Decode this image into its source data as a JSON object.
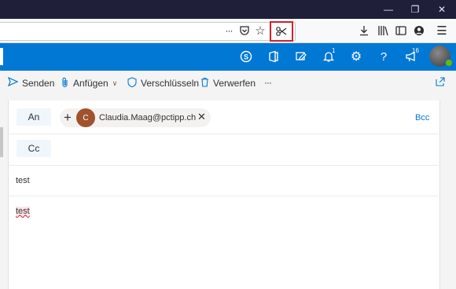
{
  "firefox": {
    "more_label": "···"
  },
  "outlook": {
    "notification_badge": "1",
    "whatsnew_badge": "16"
  },
  "commandbar": {
    "send_label": "Senden",
    "attach_label": "Anfügen",
    "encrypt_label": "Verschlüsseln",
    "discard_label": "Verwerfen",
    "more_label": "···"
  },
  "compose": {
    "to_label": "An",
    "cc_label": "Cc",
    "bcc_label": "Bcc",
    "recipient_initial": "C",
    "recipient_email": "Claudia.Maag@pctipp.ch",
    "subject": "test",
    "body": "test"
  },
  "colors": {
    "outlook_blue": "#0078d4",
    "highlight_red": "#d4202a",
    "avatar_brown": "#a0522d"
  },
  "icons": [
    "minimize-icon",
    "restore-icon",
    "close-icon",
    "more-icon",
    "pocket-icon",
    "bookmark-star-icon",
    "screenshot-icon",
    "download-icon",
    "library-icon",
    "sidebar-icon",
    "account-icon",
    "menu-icon",
    "skype-icon",
    "office-icon",
    "feedback-icon",
    "bell-icon",
    "gear-icon",
    "help-icon",
    "megaphone-icon",
    "send-icon",
    "paperclip-icon",
    "shield-icon",
    "trash-icon",
    "popout-icon",
    "plus-icon",
    "remove-recipient-icon"
  ]
}
